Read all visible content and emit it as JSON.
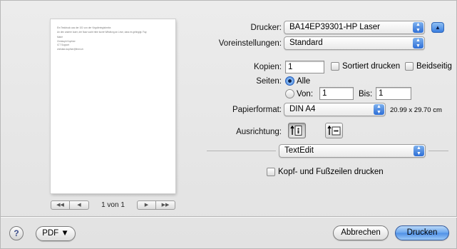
{
  "preview": {
    "lines": [
      "Ein Testdruck aus der 101 von der Virgolieringishreke.",
      "An den andere Icaer, der Naw sucht nthe kunte Witsifung an Lese, dass es gelingigt. Fay.",
      "Marié",
      "Christoph Kopfner\nICT Support",
      "christian.kopfner@thmi.ch"
    ],
    "pager_label": "1 von 1",
    "first_btn": "◀◀",
    "prev_btn": "◀",
    "next_btn": "▶",
    "last_btn": "▶▶"
  },
  "printer": {
    "label": "Drucker:",
    "value": "BA14EP39301-HP Laser"
  },
  "presets": {
    "label": "Voreinstellungen:",
    "value": "Standard"
  },
  "copies": {
    "label": "Kopien:",
    "value": "1",
    "collate_label": "Sortiert drucken",
    "duplex_label": "Beidseitig"
  },
  "pages": {
    "label": "Seiten:",
    "all_label": "Alle",
    "from_label": "Von:",
    "from_value": "1",
    "to_label": "Bis:",
    "to_value": "1"
  },
  "paper": {
    "label": "Papierformat:",
    "value": "DIN A4",
    "dimensions": "20.99 x 29.70 cm"
  },
  "orientation": {
    "label": "Ausrichtung:"
  },
  "app_menu": {
    "value": "TextEdit"
  },
  "header_footer": {
    "label": "Kopf- und Fußzeilen drucken"
  },
  "footer": {
    "help": "?",
    "pdf_label": "PDF ▼",
    "cancel_label": "Abbrechen",
    "print_label": "Drucken"
  }
}
